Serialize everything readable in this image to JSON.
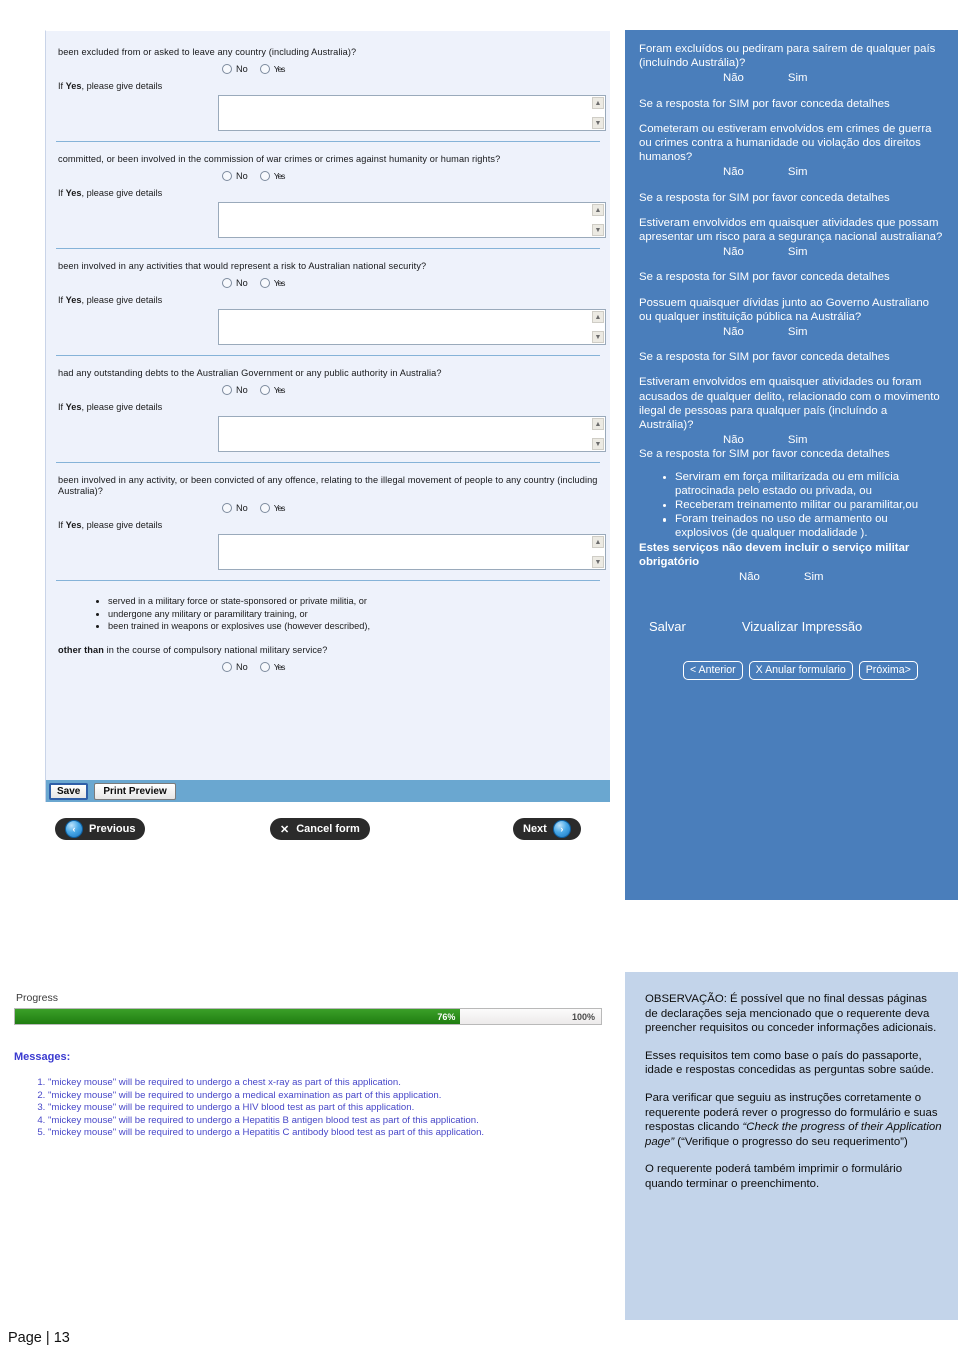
{
  "form_screenshot": {
    "questions": [
      {
        "text": "been excluded from or asked to leave any country (including Australia)?",
        "option_no": "No",
        "option_yes": "Yes",
        "details_label_prefix": "If ",
        "details_label_bold": "Yes",
        "details_label_suffix": ", please give details"
      },
      {
        "text": "committed, or been involved in the commission of war crimes or crimes against humanity or human rights?",
        "option_no": "No",
        "option_yes": "Yes"
      },
      {
        "text": "been involved in any activities that would represent a risk to Australian national security?",
        "option_no": "No",
        "option_yes": "Yes"
      },
      {
        "text": "had any outstanding debts to the Australian Government or any public authority in Australia?",
        "option_no": "No",
        "option_yes": "Yes"
      },
      {
        "text": "been involved in any activity, or been convicted of any offence, relating to the illegal movement of people to any country (including Australia)?",
        "option_no": "No",
        "option_yes": "Yes"
      }
    ],
    "military_bullets": [
      "served in a military force or state-sponsored or private militia, or",
      "undergone any military or paramilitary training, or",
      "been trained in weapons or explosives use (however described),"
    ],
    "military_tail_bold": "other than",
    "military_tail_rest": " in the course of compulsory national military service?",
    "military_no": "No",
    "military_yes": "Yes",
    "save_button": "Save",
    "print_preview_button": "Print Preview",
    "nav": {
      "previous": "Previous",
      "cancel": "Cancel form",
      "next": "Next",
      "prev_arrow": "‹",
      "next_arrow": "›",
      "cancel_x": "✕"
    },
    "scroll_up_glyph": "▲",
    "scroll_down_glyph": "▼"
  },
  "blue_panel": {
    "questions": [
      {
        "text": "Foram excluídos ou pediram para saírem de qualquer país (incluíndo Austrália)?",
        "no": "Não",
        "yes": "Sim",
        "details": "Se a resposta for SIM por favor conceda  detalhes"
      },
      {
        "text": "Cometeram ou estiveram envolvidos em crimes de guerra ou crimes contra a humanidade ou violação dos direitos humanos?",
        "no": "Não",
        "yes": "Sim",
        "details": "Se a resposta for SIM por favor conceda  detalhes"
      },
      {
        "text": "Estiveram envolvidos em quaisquer atividades que possam apresentar um risco para a segurança nacional australiana?",
        "no": "Não",
        "yes": "Sim",
        "details": "Se a resposta for SIM por favor conceda  detalhes"
      },
      {
        "text": "Possuem quaisquer dívidas junto ao Governo Australiano ou qualquer instituição pública na Austrália?",
        "no": "Não",
        "yes": "Sim",
        "details": "Se a resposta for SIM por favor conceda  detalhes"
      },
      {
        "text": "Estiveram envolvidos em quaisquer atividades  ou foram acusados de qualquer delito, relacionado com o movimento ilegal de pessoas para qualquer país (incluíndo a Austrália)?",
        "no": "Não",
        "yes": "Sim",
        "details": "Se a resposta for SIM por favor conceda  detalhes"
      }
    ],
    "military_bullets": [
      "Serviram em força militarizada ou em milícia patrocinada pelo estado ou privada, ou",
      "Receberam treinamento militar ou paramilitar,ou",
      "Foram treinados no uso de armamento ou explosivos (de qualquer modalidade )."
    ],
    "military_note": "Estes serviços não devem incluir o serviço militar obrigatório",
    "military_no": "Não",
    "military_yes": "Sim",
    "save_label": "Salvar",
    "print_preview_label": "Vizualizar Impressão",
    "wizard": {
      "previous": "< Anterior",
      "cancel": "X Anular formulario",
      "next": "Próxima>"
    }
  },
  "progress_section": {
    "label": "Progress",
    "percent": 76,
    "percent_text": "76%",
    "max_text": "100%",
    "messages_title": "Messages:",
    "messages": [
      "\"mickey mouse\" will be required to undergo a chest x-ray as part of this application.",
      "\"mickey mouse\" will be required to undergo a medical examination as part of this application.",
      "\"mickey mouse\" will be required to undergo a HIV blood test as part of this application.",
      "\"mickey mouse\" will be required to undergo a Hepatitis B antigen blood test as part of this application.",
      "\"mickey mouse\" will be required to undergo a Hepatitis C antibody blood test as part of this application."
    ]
  },
  "note_panel": {
    "p1": "OBSERVAÇÃO:  É possível que no final dessas páginas de declarações seja mencionado que o requerente deva preencher requisitos ou conceder informações adicionais.",
    "p2": "Esses requisitos tem como base o país do passaporte, idade e respostas concedidas as perguntas sobre saúde.",
    "p3_pre": "Para verificar que seguiu as instruções corretamente o requerente poderá rever  o progresso do formulário e suas respostas  clicando ",
    "p3_italic": "“Check the progress of their Application page”",
    "p3_post": " (“Verifique  o progresso do seu requerimento”)",
    "p4": "O requerente poderá também imprimir o formulário quando terminar o preenchimento."
  },
  "footer": {
    "page_label": "Page | 13"
  },
  "colors": {
    "panel_blue": "#4a7ebb",
    "panel_light_blue": "#c3d4ea",
    "form_bg": "#eef2fb",
    "progress_green": "#2d8f1c",
    "message_text": "#4747c8"
  }
}
